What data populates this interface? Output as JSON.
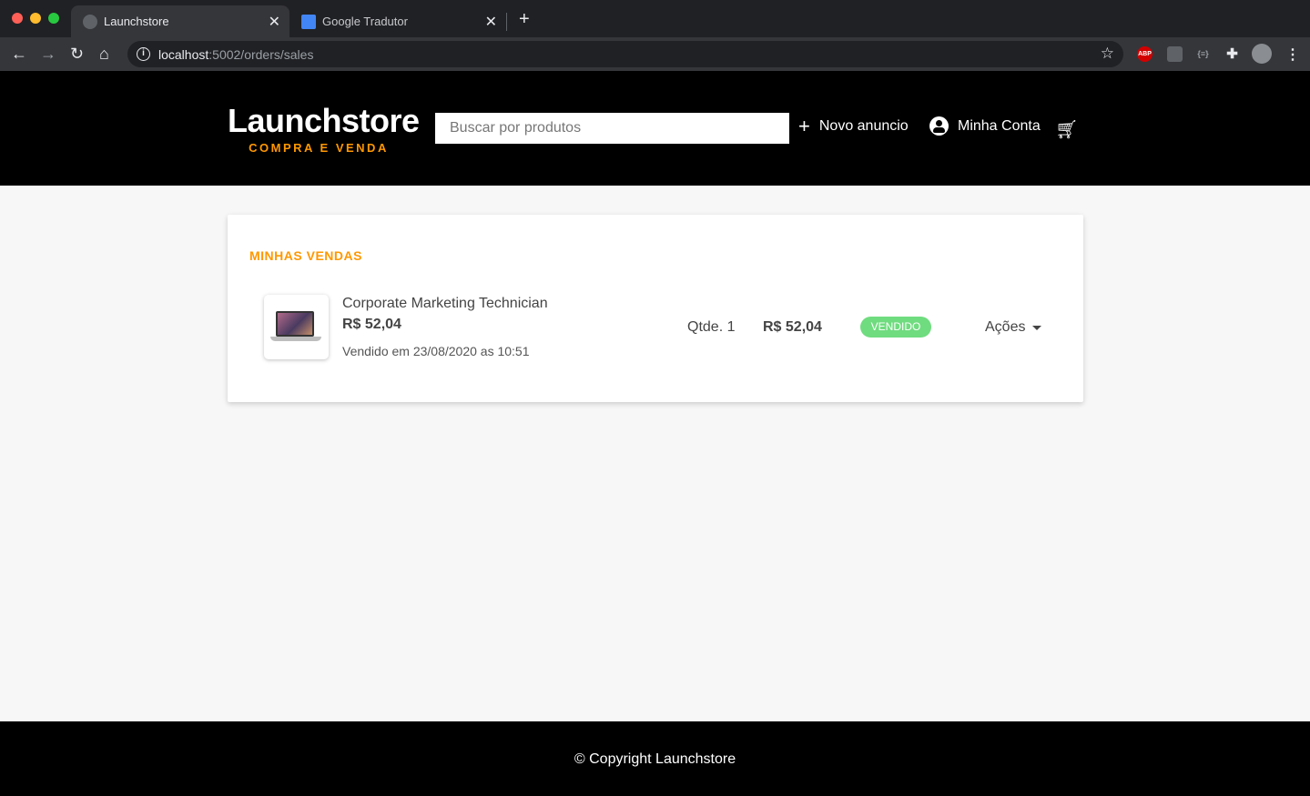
{
  "browser": {
    "tabs": [
      {
        "title": "Launchstore",
        "active": true
      },
      {
        "title": "Google Tradutor",
        "active": false
      }
    ],
    "url_host": "localhost",
    "url_path": ":5002/orders/sales",
    "extensions": {
      "abp": "ABP",
      "json": "{≡}"
    }
  },
  "header": {
    "logo_title": "Launchstore",
    "logo_subtitle": "COMPRA E VENDA",
    "search_placeholder": "Buscar por produtos",
    "new_ad_label": "Novo anuncio",
    "account_label": "Minha Conta"
  },
  "sales": {
    "title": "MINHAS VENDAS",
    "items": [
      {
        "name": "Corporate Marketing Technician",
        "price": "R$ 52,04",
        "sold_at": "Vendido em 23/08/2020 as 10:51",
        "quantity": "Qtde. 1",
        "total": "R$ 52,04",
        "status": "VENDIDO",
        "actions_label": "Ações"
      }
    ]
  },
  "footer": {
    "copyright": "© Copyright Launchstore"
  },
  "colors": {
    "accent": "#ff9800",
    "status_sold": "#6fdc7f",
    "header_bg": "#000000"
  }
}
